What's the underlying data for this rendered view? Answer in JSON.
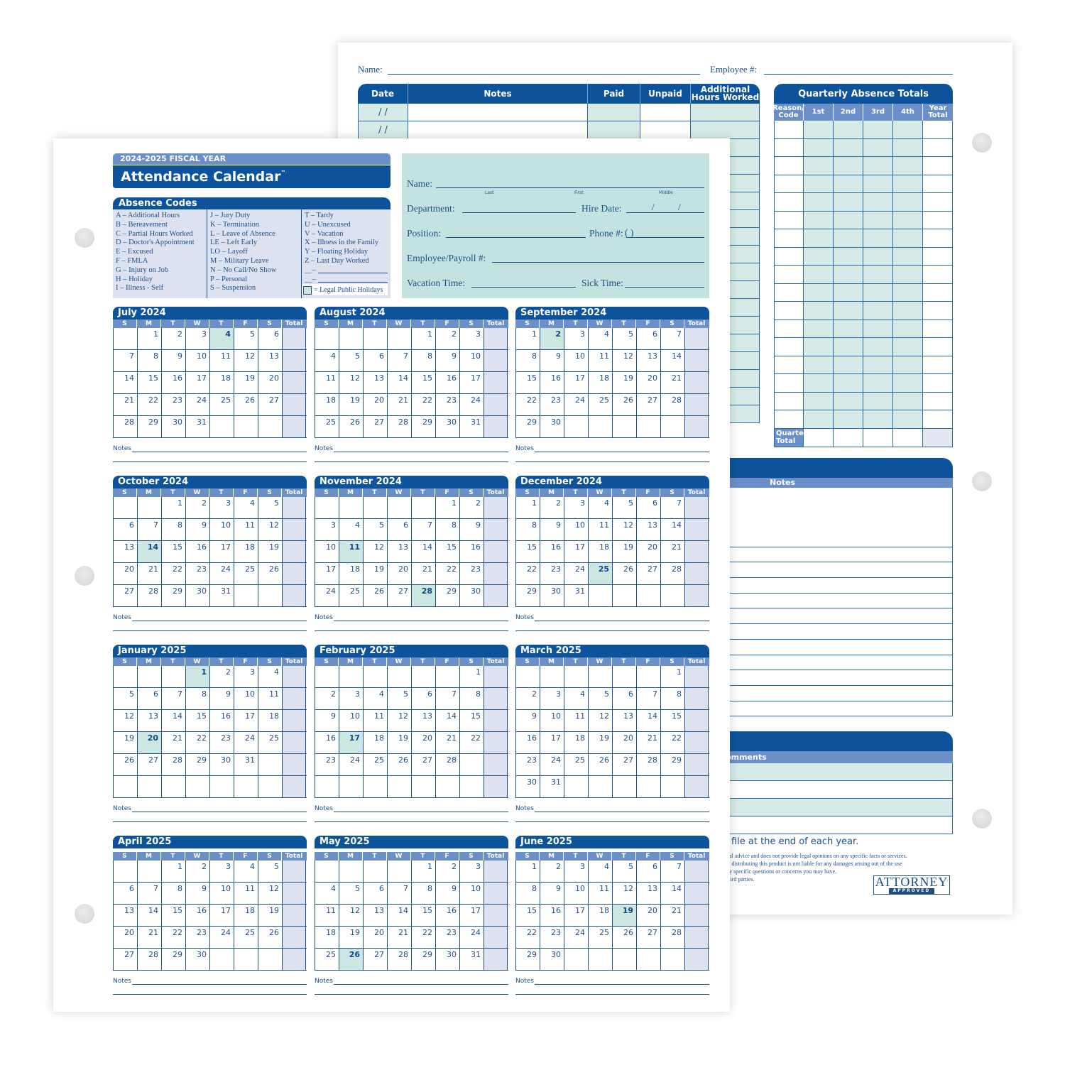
{
  "back_sheet": {
    "name_label": "Name:",
    "employee_label": "Employee #:",
    "log_table": {
      "headers": [
        "Date",
        "Notes",
        "Paid",
        "Unpaid",
        "Additional Hours Worked"
      ],
      "date_placeholder": "/   /",
      "row_count": 18
    },
    "quarterly": {
      "title": "Quarterly Absence Totals",
      "headers": [
        "Reason/ Code",
        "1st",
        "2nd",
        "3rd",
        "4th",
        "Year Total"
      ],
      "row_count": 17,
      "total_label": "Quarter Total"
    },
    "notes_header": "Notes",
    "comments_header": "Comments",
    "file_note": "nel file at the end of each year.",
    "disclaimer_lines": [
      "for legal advice and does not provide legal opinions on any specific facts or services.",
      "cing or distributing this product is not liable for any damages arising out of the use",
      "and any specific questions or concerns you may have.",
      "with third parties."
    ],
    "logo": {
      "main": "ATTORNEY",
      "sub": "APPROVED"
    }
  },
  "front_sheet": {
    "fiscal_year": "2024-2025 FISCAL YEAR",
    "title": "Attendance Calendar",
    "trademark": "™",
    "absence_codes": {
      "header": "Absence Codes",
      "columns": [
        [
          "A – Additional Hours",
          "B – Bereavement",
          "C – Partial Hours Worked",
          "D – Doctor's Appointment",
          "E – Excused",
          "F – FMLA",
          "G – Injury on Job",
          "H – Holiday",
          "I – Illness - Self"
        ],
        [
          "J – Jury Duty",
          "K – Termination",
          "L – Leave of Absence",
          "LE – Left Early",
          "LO – Layoff",
          "M – Military Leave",
          "N – No Call/No Show",
          "P – Personal",
          "S – Suspension"
        ],
        [
          "T – Tardy",
          "U – Unexcused",
          "V – Vacation",
          "X – Illness in the Family",
          "Y – Floating Holiday",
          "Z – Last Day Worked"
        ]
      ],
      "blank_code": "__–",
      "legend": "= Legal Public Holidays"
    },
    "employee_info": {
      "name": "Name:",
      "name_sub": [
        "Last",
        "First",
        "Middle"
      ],
      "department": "Department:",
      "hire_date": "Hire Date:",
      "hire_date_sep": "/",
      "position": "Position:",
      "phone": "Phone #:",
      "phone_paren": "(      )",
      "employee_payroll": "Employee/Payroll #:",
      "vacation": "Vacation Time:",
      "sick": "Sick Time:"
    },
    "dow": [
      "S",
      "M",
      "T",
      "W",
      "T",
      "F",
      "S"
    ],
    "total_label": "Total",
    "notes_label": "Notes",
    "months": [
      {
        "name": "July 2024",
        "start": 1,
        "days": 31,
        "weeks": 5,
        "holidays": [
          4
        ]
      },
      {
        "name": "August 2024",
        "start": 4,
        "days": 31,
        "weeks": 5,
        "holidays": []
      },
      {
        "name": "September 2024",
        "start": 0,
        "days": 30,
        "weeks": 5,
        "holidays": [
          2
        ]
      },
      {
        "name": "October 2024",
        "start": 2,
        "days": 31,
        "weeks": 5,
        "holidays": [
          14
        ]
      },
      {
        "name": "November 2024",
        "start": 5,
        "days": 30,
        "weeks": 5,
        "holidays": [
          11,
          28
        ]
      },
      {
        "name": "December 2024",
        "start": 0,
        "days": 31,
        "weeks": 5,
        "holidays": [
          25
        ]
      },
      {
        "name": "January 2025",
        "start": 3,
        "days": 31,
        "weeks": 6,
        "holidays": [
          1,
          20
        ]
      },
      {
        "name": "February 2025",
        "start": 6,
        "days": 28,
        "weeks": 6,
        "holidays": [
          17
        ]
      },
      {
        "name": "March 2025",
        "start": 6,
        "days": 31,
        "weeks": 6,
        "holidays": []
      },
      {
        "name": "April 2025",
        "start": 2,
        "days": 30,
        "weeks": 5,
        "holidays": []
      },
      {
        "name": "May 2025",
        "start": 4,
        "days": 31,
        "weeks": 5,
        "holidays": [
          26
        ]
      },
      {
        "name": "June 2025",
        "start": 0,
        "days": 30,
        "weeks": 5,
        "holidays": [
          19
        ]
      }
    ]
  },
  "colors": {
    "primary": "#0c539b",
    "secondary": "#6b8fc8",
    "holiday_tint": "#cce6e2",
    "total_tint": "#dde2f0",
    "text": "#1d4f86"
  }
}
